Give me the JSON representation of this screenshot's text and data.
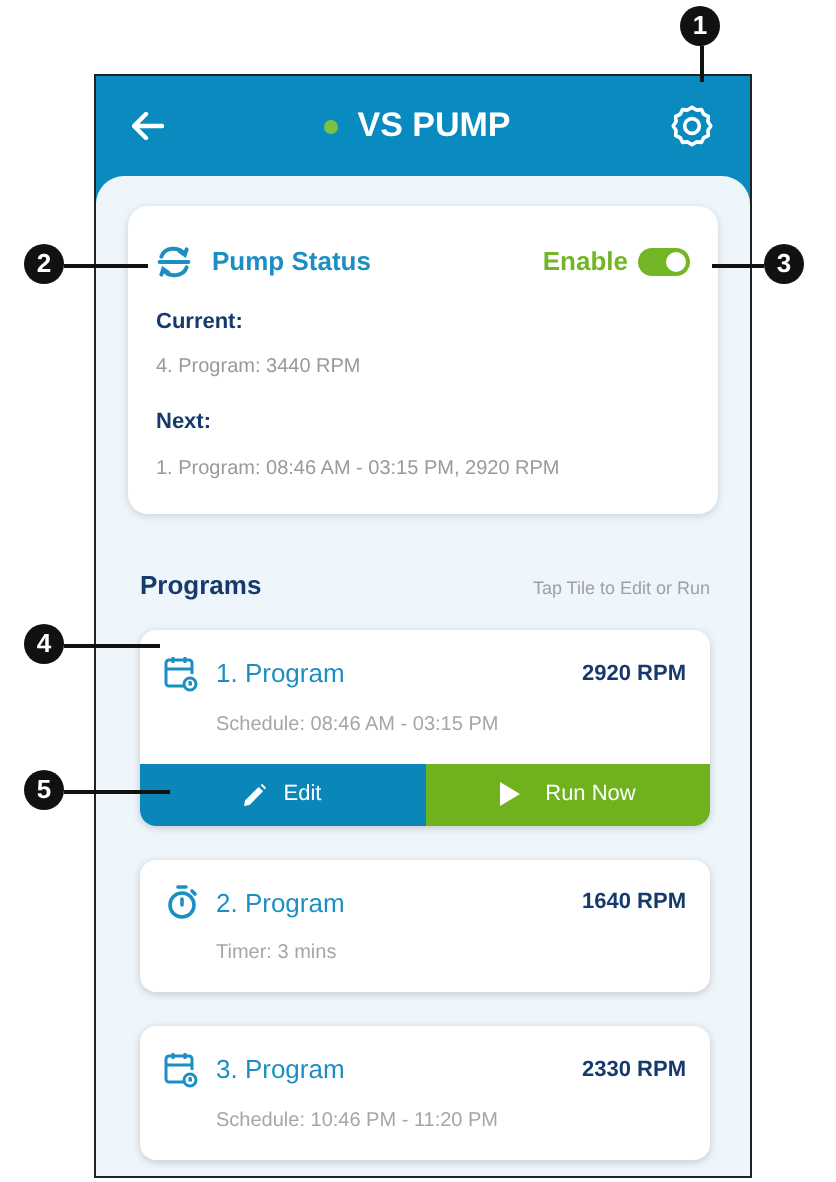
{
  "header": {
    "title": "VS PUMP",
    "online": true
  },
  "status": {
    "title": "Pump Status",
    "toggle_label": "Enable",
    "enabled": true,
    "current_label": "Current:",
    "current_value": "4. Program: 3440 RPM",
    "next_label": "Next:",
    "next_value": "1. Program: 08:46 AM - 03:15 PM, 2920 RPM"
  },
  "programs": {
    "heading": "Programs",
    "hint": "Tap Tile to Edit or Run",
    "items": [
      {
        "kind": "schedule",
        "name": "1. Program",
        "rpm": "2920 RPM",
        "detail": "Schedule: 08:46 AM - 03:15 PM",
        "actions": {
          "edit_label": "Edit",
          "run_label": "Run Now"
        }
      },
      {
        "kind": "timer",
        "name": "2. Program",
        "rpm": "1640 RPM",
        "detail": "Timer: 3 mins"
      },
      {
        "kind": "schedule",
        "name": "3. Program",
        "rpm": "2330 RPM",
        "detail": "Schedule: 10:46 PM - 11:20 PM"
      }
    ]
  },
  "callouts": [
    "1",
    "2",
    "3",
    "4",
    "5"
  ]
}
